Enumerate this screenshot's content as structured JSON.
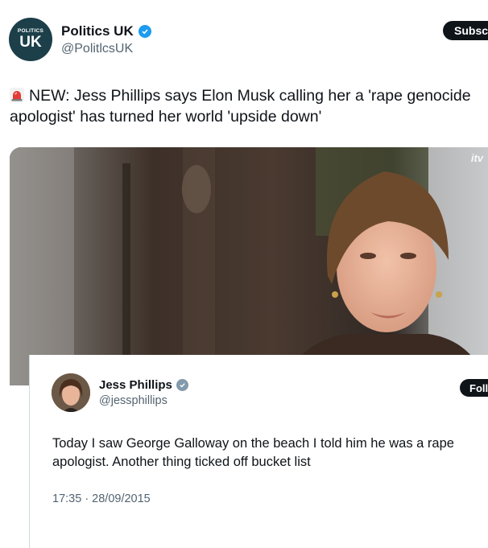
{
  "main_tweet": {
    "author_name": "Politics UK",
    "author_handle": "@PolitlcsUK",
    "avatar_text_small": "POLITICS",
    "avatar_text_big": "UK",
    "subscribe_label": "Subscr",
    "text": "NEW: Jess Phillips says Elon Musk calling her a 'rape genocide apologist' has turned her world 'upside down'",
    "media": {
      "watermark": "itv"
    }
  },
  "quoted_tweet": {
    "author_name": "Jess Phillips",
    "author_handle": "@jessphillips",
    "follow_label": "Foll",
    "text": "Today I saw George Galloway on the beach I told him he was a rape apologist. Another thing ticked off bucket list",
    "timestamp": "17:35 · 28/09/2015"
  },
  "colors": {
    "verified_blue": "#1d9bf0",
    "verified_grey": "#829aab",
    "avatar_bg": "#1c3f4a",
    "text_primary": "#0f1419",
    "text_secondary": "#536471"
  },
  "icons": [
    "siren-emoji-icon",
    "verified-badge-icon",
    "verified-grey-badge-icon"
  ]
}
